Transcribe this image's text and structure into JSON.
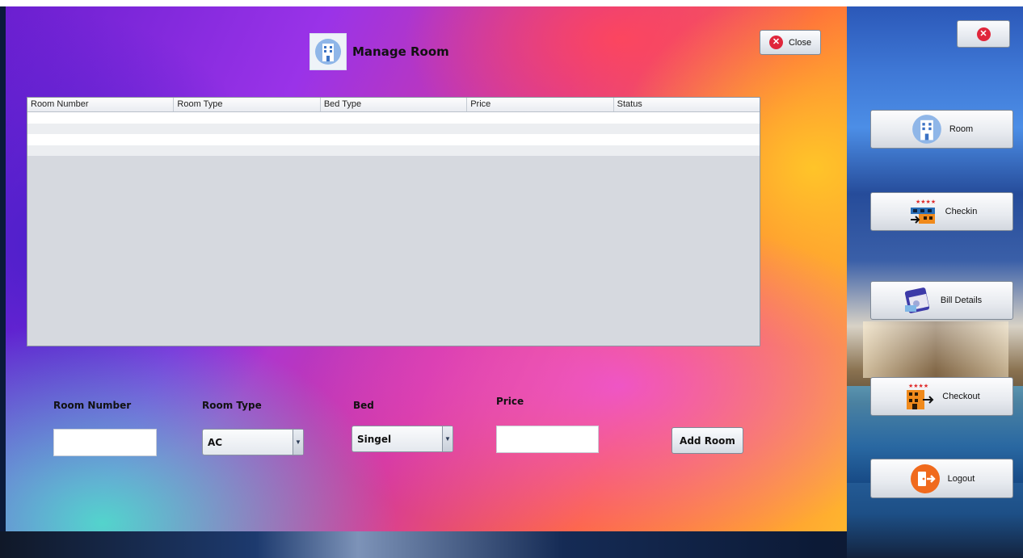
{
  "window": {
    "title": "Manage Room",
    "close_label": "Close"
  },
  "table": {
    "columns": [
      "Room Number",
      "Room Type",
      "Bed Type",
      "Price",
      "Status"
    ],
    "rows": []
  },
  "form": {
    "room_number_label": "Room Number",
    "room_number_value": "",
    "room_type_label": "Room Type",
    "room_type_value": "AC",
    "bed_label": "Bed",
    "bed_value": "Singel",
    "price_label": "Price",
    "price_value": "",
    "add_room_label": "Add Room"
  },
  "sidebar": {
    "items": [
      {
        "label": "Room",
        "icon": "building-icon"
      },
      {
        "label": "Checkin",
        "icon": "hotel-checkin-icon"
      },
      {
        "label": "Bill Details",
        "icon": "bill-icon"
      },
      {
        "label": "Checkout",
        "icon": "hotel-checkout-icon"
      },
      {
        "label": "Logout",
        "icon": "logout-icon"
      }
    ]
  },
  "colors": {
    "close_red": "#e0263b",
    "logout_orange": "#f06a1d"
  }
}
